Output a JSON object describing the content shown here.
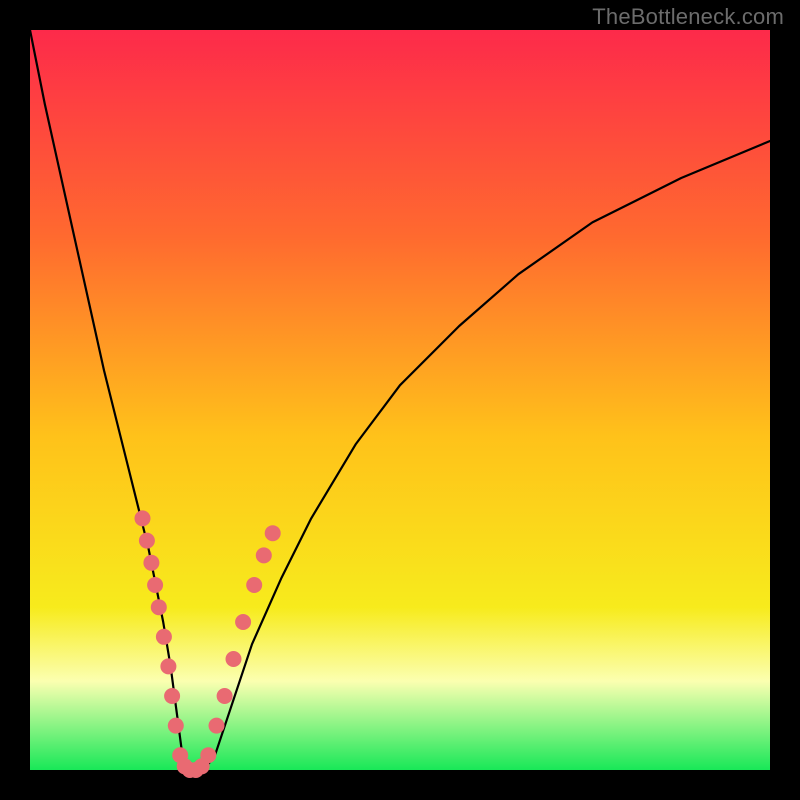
{
  "watermark": "TheBottleneck.com",
  "colors": {
    "top": "#fd2a4a",
    "upper": "#ff6a2f",
    "mid": "#ffc21a",
    "lowmid": "#f7eb1c",
    "pale": "#fbffb0",
    "green": "#18e858",
    "marker": "#e96a72",
    "curve": "#000000"
  },
  "chart_data": {
    "type": "line",
    "title": "",
    "xlabel": "",
    "ylabel": "",
    "xlim": [
      0,
      100
    ],
    "ylim": [
      0,
      100
    ],
    "grid": false,
    "legend": false,
    "series": [
      {
        "name": "bottleneck-curve",
        "x": [
          0,
          2,
          4,
          6,
          8,
          10,
          12,
          14,
          16,
          18,
          19,
          19.8,
          20.6,
          21.8,
          23.5,
          25,
          27,
          30,
          34,
          38,
          44,
          50,
          58,
          66,
          76,
          88,
          100
        ],
        "y": [
          100,
          90,
          81,
          72,
          63,
          54,
          46,
          38,
          30,
          20,
          14,
          8,
          2,
          0,
          0,
          2,
          8,
          17,
          26,
          34,
          44,
          52,
          60,
          67,
          74,
          80,
          85
        ]
      }
    ],
    "markers": {
      "name": "highlight-dots",
      "color": "#e96a72",
      "points": [
        {
          "x": 15.2,
          "y": 34
        },
        {
          "x": 15.8,
          "y": 31
        },
        {
          "x": 16.4,
          "y": 28
        },
        {
          "x": 16.9,
          "y": 25
        },
        {
          "x": 17.4,
          "y": 22
        },
        {
          "x": 18.1,
          "y": 18
        },
        {
          "x": 18.7,
          "y": 14
        },
        {
          "x": 19.2,
          "y": 10
        },
        {
          "x": 19.7,
          "y": 6
        },
        {
          "x": 20.3,
          "y": 2
        },
        {
          "x": 20.9,
          "y": 0.5
        },
        {
          "x": 21.6,
          "y": 0
        },
        {
          "x": 22.4,
          "y": 0
        },
        {
          "x": 23.2,
          "y": 0.5
        },
        {
          "x": 24.1,
          "y": 2
        },
        {
          "x": 25.2,
          "y": 6
        },
        {
          "x": 26.3,
          "y": 10
        },
        {
          "x": 27.5,
          "y": 15
        },
        {
          "x": 28.8,
          "y": 20
        },
        {
          "x": 30.3,
          "y": 25
        },
        {
          "x": 31.6,
          "y": 29
        },
        {
          "x": 32.8,
          "y": 32
        }
      ]
    },
    "annotations": []
  }
}
